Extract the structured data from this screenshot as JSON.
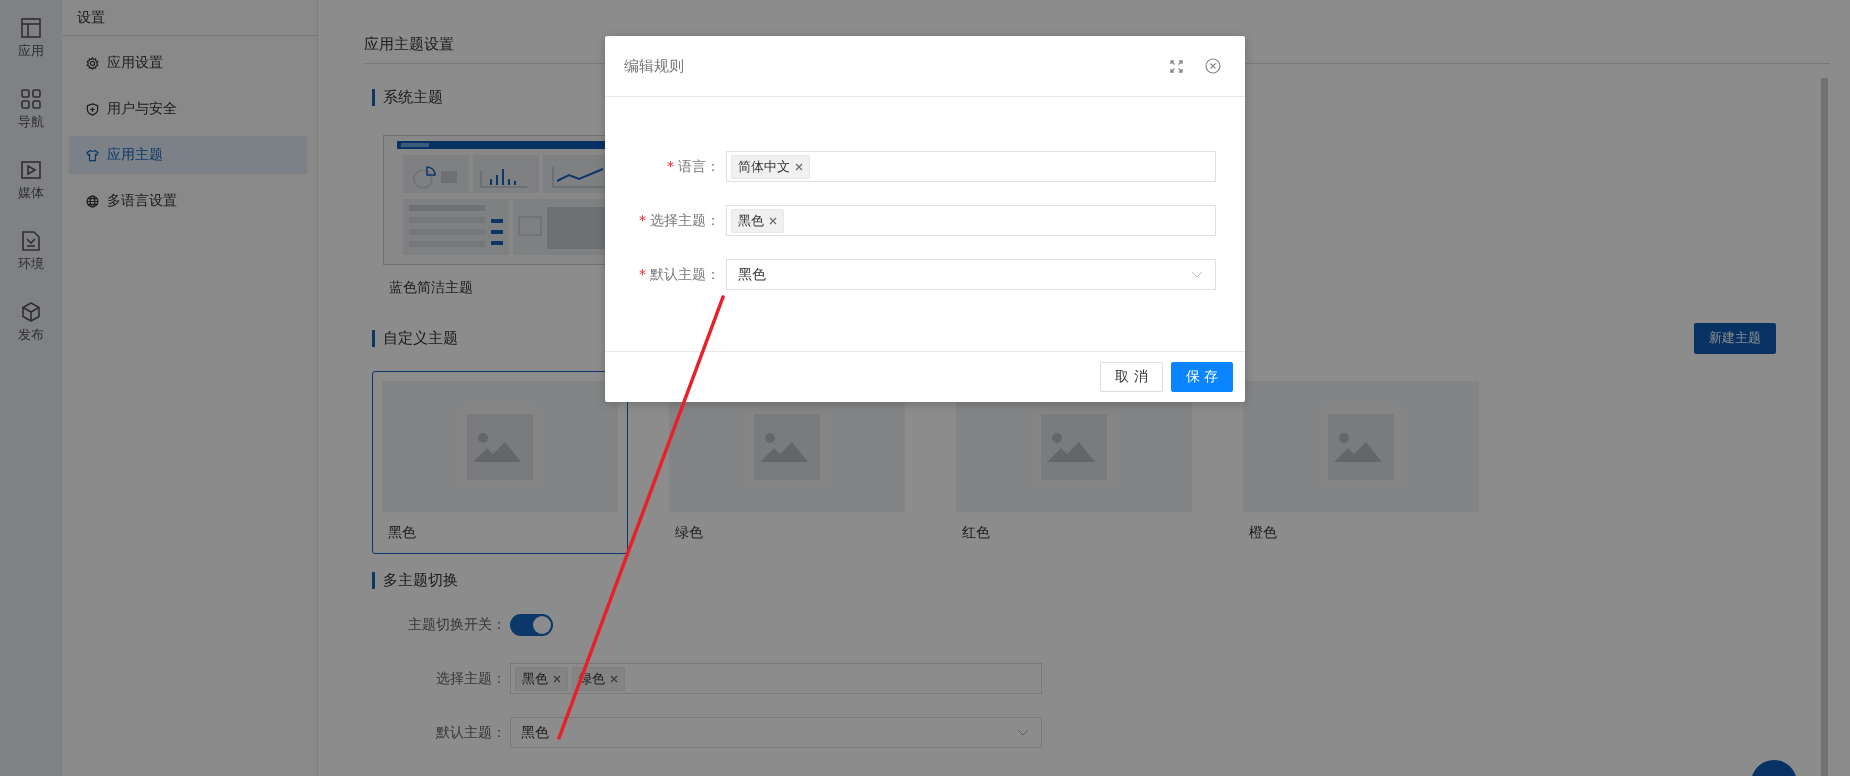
{
  "rail": [
    {
      "label": "应用"
    },
    {
      "label": "导航"
    },
    {
      "label": "媒体"
    },
    {
      "label": "环境"
    },
    {
      "label": "发布"
    }
  ],
  "settings_sidebar": {
    "title": "设置",
    "items": [
      {
        "label": "应用设置",
        "selected": false
      },
      {
        "label": "用户与安全",
        "selected": false
      },
      {
        "label": "应用主题",
        "selected": true
      },
      {
        "label": "多语言设置",
        "selected": false
      }
    ]
  },
  "main": {
    "title": "应用主题设置",
    "system_themes": {
      "heading": "系统主题",
      "cards": [
        {
          "label": "蓝色简洁主题"
        }
      ]
    },
    "custom_themes": {
      "heading": "自定义主题",
      "new_button": "新建主题",
      "cards": [
        {
          "label": "黑色",
          "selected": true
        },
        {
          "label": "绿色",
          "selected": false
        },
        {
          "label": "红色",
          "selected": false
        },
        {
          "label": "橙色",
          "selected": false
        }
      ]
    },
    "multi_theme": {
      "heading": "多主题切换",
      "switch": {
        "label": "主题切换开关：",
        "on": true
      },
      "select": {
        "label": "选择主题：",
        "tags": [
          "黑色",
          "绿色"
        ]
      },
      "default": {
        "label": "默认主题：",
        "value": "黑色"
      }
    }
  },
  "dialog": {
    "title": "编辑规则",
    "fields": [
      {
        "label": "语言：",
        "required_mark": "*",
        "kind": "tags",
        "tags": [
          "简体中文"
        ]
      },
      {
        "label": "选择主题：",
        "required_mark": "*",
        "kind": "tags",
        "tags": [
          "黑色"
        ]
      },
      {
        "label": "默认主题：",
        "required_mark": "*",
        "kind": "select",
        "value": "黑色"
      }
    ],
    "buttons": [
      {
        "label": "取 消",
        "kind": "default"
      },
      {
        "label": "保 存",
        "kind": "primary"
      }
    ]
  }
}
